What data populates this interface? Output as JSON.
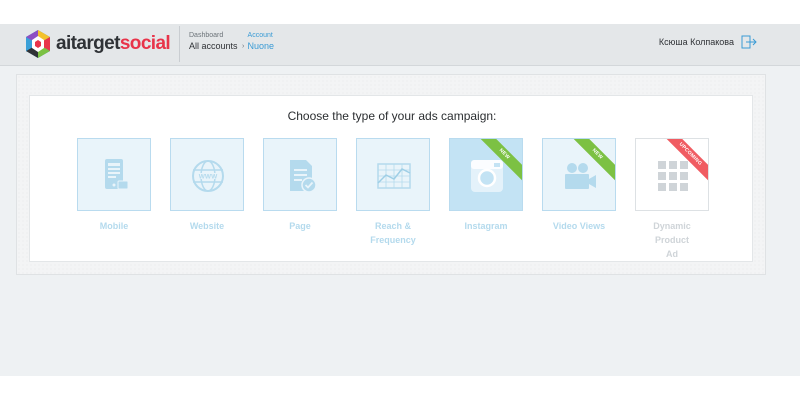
{
  "header": {
    "logo": {
      "part1": "aitarget",
      "part2": "social"
    },
    "breadcrumbs": [
      {
        "small": "Dashboard",
        "main": "All accounts"
      },
      {
        "small": "Account",
        "main": "Nuone"
      }
    ],
    "breadcrumb_separator": "›",
    "user_name": "Ксюша Колпакова"
  },
  "campaign": {
    "title": "Choose the type of your ads campaign:",
    "types": [
      {
        "label": "Mobile",
        "icon": "mobile-icon"
      },
      {
        "label": "Website",
        "icon": "globe-www-icon"
      },
      {
        "label": "Page",
        "icon": "page-check-icon"
      },
      {
        "label_line1": "Reach &",
        "label_line2": "Frequency",
        "icon": "reach-chart-icon"
      },
      {
        "label": "Instagram",
        "icon": "instagram-camera-icon",
        "ribbon": "NEW"
      },
      {
        "label": "Video Views",
        "icon": "video-camera-icon",
        "ribbon": "NEW"
      },
      {
        "label_line1": "Dynamic Product",
        "label_line2": "Ad",
        "icon": "product-grid-icon",
        "ribbon": "UPCOMING"
      }
    ]
  },
  "colors": {
    "accent": "#3a9bd5",
    "brand_red": "#e8344a",
    "tile_blue": "#b9dbef",
    "ribbon_new": "#7cc143",
    "ribbon_upcoming": "#f05c62"
  }
}
